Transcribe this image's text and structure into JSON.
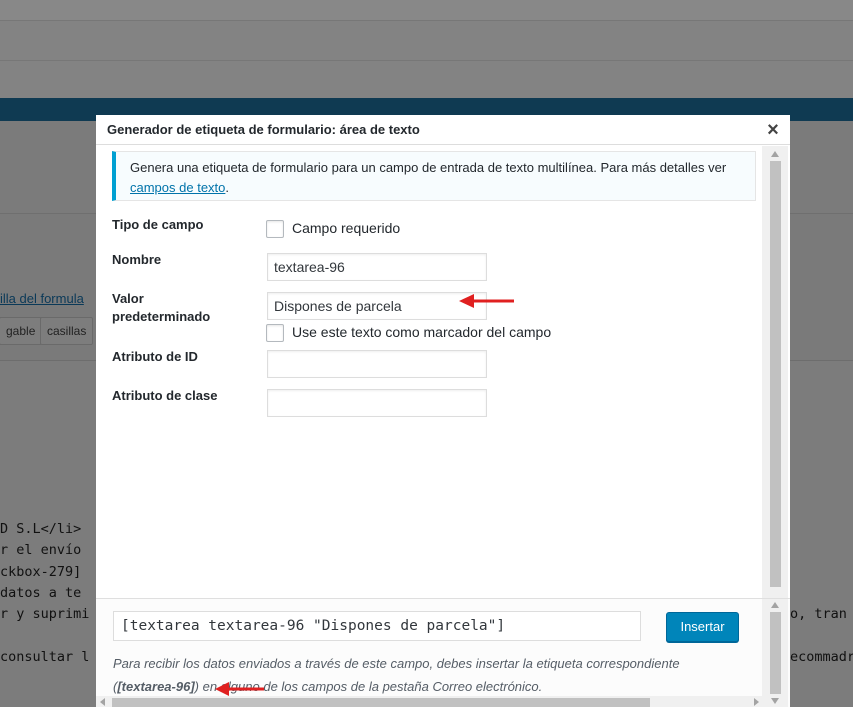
{
  "background": {
    "link_text": "illa del formula",
    "tags": [
      "gable",
      "casillas"
    ],
    "code_lines": [
      "D S.L</li>",
      "r el envío",
      "ckbox-279]",
      "datos a te",
      "r y suprimi",
      "",
      "consultar l"
    ],
    "code_right": [
      "o, tran",
      "ecommadr"
    ]
  },
  "modal": {
    "title": "Generador de etiqueta de formulario: área de texto",
    "close_label": "×",
    "notice_text": "Genera una etiqueta de formulario para un campo de entrada de texto multilínea. Para más detalles ver ",
    "notice_link": "campos de texto",
    "notice_end": ".",
    "fields": {
      "tipo_label": "Tipo de campo",
      "required_label": "Campo requerido",
      "nombre_label": "Nombre",
      "nombre_value": "textarea-96",
      "valor_label_1": "Valor",
      "valor_label_2": "predeterminado",
      "valor_value": "Dispones de parcela",
      "placeholder_label": "Use este texto como marcador del campo",
      "id_label": "Atributo de ID",
      "id_value": "",
      "clase_label": "Atributo de clase",
      "clase_value": ""
    },
    "insert": {
      "tag_value": "[textarea textarea-96 \"Dispones de parcela\"]",
      "button_label": "Insertar",
      "desc_1": "Para recibir los datos enviados a través de este campo, debes insertar la etiqueta correspondiente",
      "desc_open": "(",
      "desc_tag": "[textarea-96]",
      "desc_2": ") en alguno de los campos de la pestaña Correo electrónico."
    }
  },
  "colors": {
    "accent": "#0085ba",
    "notice_border": "#00a0d2",
    "arrow": "#e02020"
  }
}
